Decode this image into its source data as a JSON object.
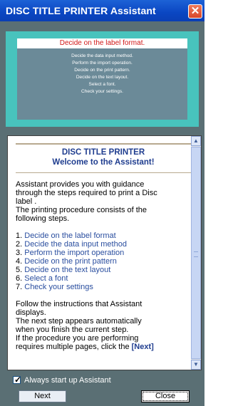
{
  "window": {
    "title": "DISC TITLE PRINTER Assistant",
    "close_glyph": "✕"
  },
  "steps_panel": {
    "current": "Decide on the label format.",
    "items": [
      "Decide the data input method.",
      "Perform the import operation.",
      "Decide on the print pattern.",
      "Decide on the text layout.",
      "Select a font.",
      "Check your settings."
    ]
  },
  "content": {
    "heading1": "DISC TITLE PRINTER",
    "heading2": "Welcome to the Assistant!",
    "intro_lines": [
      "Assistant provides you with guidance",
      "through the steps required to print a Disc",
      "label .",
      "The printing procedure consists of the",
      "following steps."
    ],
    "steps": [
      {
        "num": "1.",
        "text": "Decide on the label format"
      },
      {
        "num": "2.",
        "text": "Decide the data input method"
      },
      {
        "num": "3.",
        "text": "Perform the import operation"
      },
      {
        "num": "4.",
        "text": "Decide on the print pattern"
      },
      {
        "num": "5.",
        "text": "Decide on the text layout"
      },
      {
        "num": "6.",
        "text": "Select a font"
      },
      {
        "num": "7.",
        "text": "Check your settings"
      }
    ],
    "follow_lines": [
      "Follow the instructions that Assistant",
      "displays.",
      "The next step appears automatically",
      "when you finish the current step.",
      "If the procedure you are performing"
    ],
    "last_line_prefix": "requires multiple pages, click the ",
    "last_line_keyword": "[Next]"
  },
  "scrollbar": {
    "up_glyph": "▲",
    "down_glyph": "▼"
  },
  "always_start": {
    "label": "Always start up Assistant",
    "checked": true,
    "check_glyph": "✓"
  },
  "buttons": {
    "next": "Next",
    "close": "Close"
  }
}
